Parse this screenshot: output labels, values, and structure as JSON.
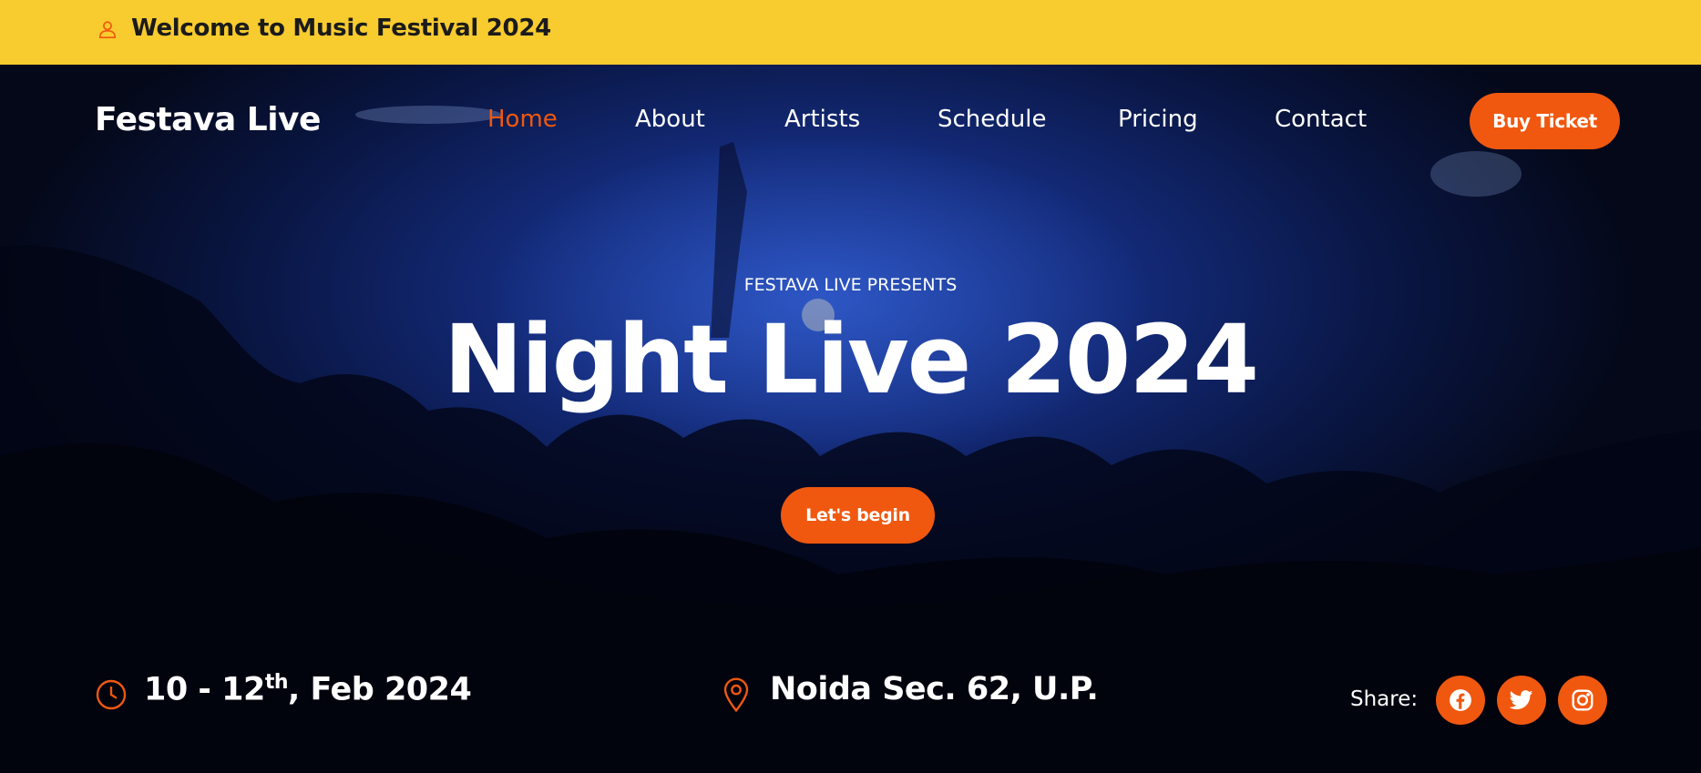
{
  "topbar": {
    "welcome": "Welcome to Music Festival 2024",
    "icon": "user-icon"
  },
  "header": {
    "brand": "Festava Live",
    "nav": [
      {
        "label": "Home",
        "active": true
      },
      {
        "label": "About",
        "active": false
      },
      {
        "label": "Artists",
        "active": false
      },
      {
        "label": "Schedule",
        "active": false
      },
      {
        "label": "Pricing",
        "active": false
      },
      {
        "label": "Contact",
        "active": false
      }
    ],
    "cta": "Buy Ticket"
  },
  "hero": {
    "eyebrow": "FESTAVA LIVE PRESENTS",
    "title": "Night Live 2024",
    "cta": "Let's begin"
  },
  "details": {
    "date_prefix": "10 - 12",
    "date_sup": "th",
    "date_suffix": ", Feb 2024",
    "date_icon": "clock-icon",
    "location": "Noida Sec. 62, U.P.",
    "location_icon": "map-pin-icon",
    "share_label": "Share:",
    "social": [
      "facebook-icon",
      "twitter-icon",
      "instagram-icon"
    ]
  },
  "colors": {
    "topbar_bg": "#f8cb2e",
    "accent": "#f0580f",
    "hero_blue": "#132a78",
    "text": "#ffffff"
  }
}
